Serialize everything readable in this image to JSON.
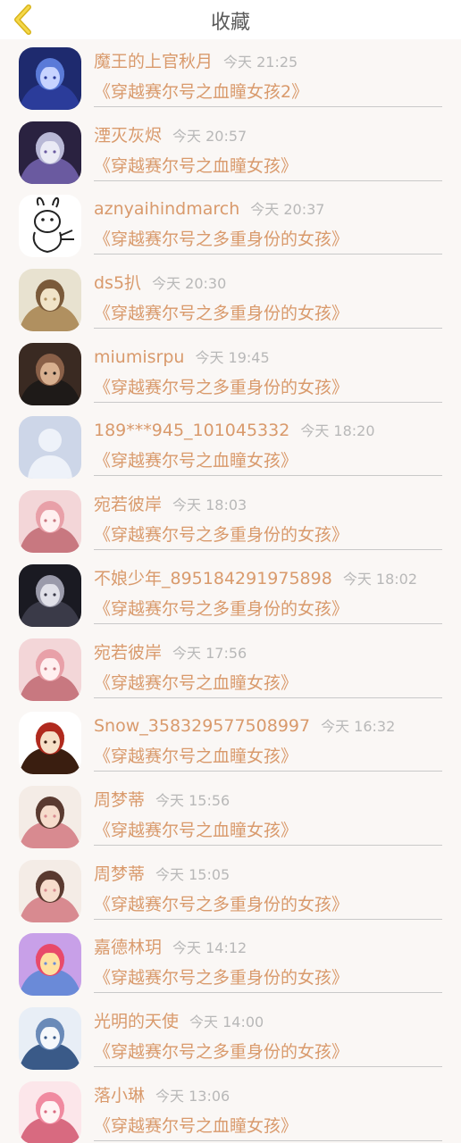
{
  "header": {
    "title": "收藏",
    "back_icon": "chevron-left-icon",
    "accent": "#e2bb1e"
  },
  "colors": {
    "name": "#d99a6c",
    "time": "#b8b8b8",
    "book": "#d99a6c"
  },
  "items": [
    {
      "name": "魔王的上官秋月",
      "time": "今天 21:25",
      "book": "《穿越赛尔号之血瞳女孩2》",
      "avatar": "anime-blue-avatar"
    },
    {
      "name": "湮灭灰烬",
      "time": "今天 20:57",
      "book": "《穿越赛尔号之血瞳女孩》",
      "avatar": "anime-silver-hair-avatar"
    },
    {
      "name": "aznyaihindmarch",
      "time": "今天 20:37",
      "book": "《穿越赛尔号之多重身份的女孩》",
      "avatar": "rabbit-sketch-avatar"
    },
    {
      "name": "ds5扒",
      "time": "今天 20:30",
      "book": "《穿越赛尔号之多重身份的女孩》",
      "avatar": "anime-girl-hat-avatar"
    },
    {
      "name": "miumisrpu",
      "time": "今天 19:45",
      "book": "《穿越赛尔号之多重身份的女孩》",
      "avatar": "photo-boy-avatar"
    },
    {
      "name": "189***945_101045332",
      "time": "今天 18:20",
      "book": "《穿越赛尔号之血瞳女孩》",
      "avatar": "default-user-avatar"
    },
    {
      "name": "宛若彼岸",
      "time": "今天 18:03",
      "book": "《穿越赛尔号之多重身份的女孩》",
      "avatar": "anime-pink-floral-avatar"
    },
    {
      "name": "不娘少年_895184291975898",
      "time": "今天 18:02",
      "book": "《穿越赛尔号之多重身份的女孩》",
      "avatar": "anime-dark-boy-avatar"
    },
    {
      "name": "宛若彼岸",
      "time": "今天 17:56",
      "book": "《穿越赛尔号之血瞳女孩》",
      "avatar": "anime-pink-floral-avatar"
    },
    {
      "name": "Snow_358329577508997",
      "time": "今天 16:32",
      "book": "《穿越赛尔号之血瞳女孩》",
      "avatar": "chibi-red-hair-avatar"
    },
    {
      "name": "周梦蒂",
      "time": "今天 15:56",
      "book": "《穿越赛尔号之血瞳女孩》",
      "avatar": "anime-flower-girl-avatar"
    },
    {
      "name": "周梦蒂",
      "time": "今天 15:05",
      "book": "《穿越赛尔号之多重身份的女孩》",
      "avatar": "anime-flower-girl-avatar"
    },
    {
      "name": "嘉德林玥",
      "time": "今天 14:12",
      "book": "《穿越赛尔号之多重身份的女孩》",
      "avatar": "anime-colorful-girl-avatar"
    },
    {
      "name": "光明的天使",
      "time": "今天 14:00",
      "book": "《穿越赛尔号之多重身份的女孩》",
      "avatar": "anime-blue-sketch-avatar"
    },
    {
      "name": "落小琳",
      "time": "今天 13:06",
      "book": "《穿越赛尔号之血瞳女孩》",
      "avatar": "anime-pink-hair-avatar"
    }
  ]
}
